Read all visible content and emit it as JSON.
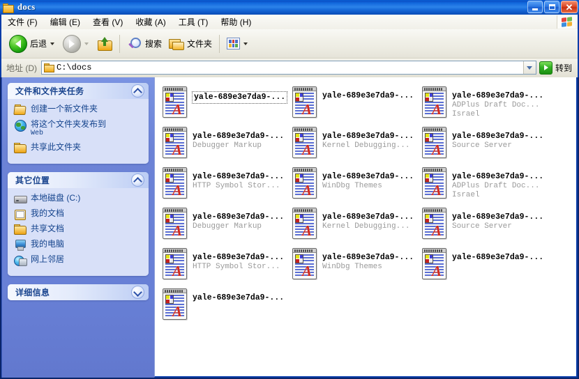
{
  "window": {
    "title": "docs",
    "title_icon": "folder-icon",
    "buttons": {
      "minimize": "minimize-button",
      "maximize": "maximize-button",
      "close": "close-button"
    }
  },
  "menubar": {
    "items": [
      {
        "label": "文件 (F)",
        "name": "menu-file"
      },
      {
        "label": "编辑 (E)",
        "name": "menu-edit"
      },
      {
        "label": "查看 (V)",
        "name": "menu-view"
      },
      {
        "label": "收藏 (A)",
        "name": "menu-favorites"
      },
      {
        "label": "工具 (T)",
        "name": "menu-tools"
      },
      {
        "label": "帮助 (H)",
        "name": "menu-help"
      }
    ],
    "logo": "windows-flag-icon"
  },
  "toolbar": {
    "back_label": "后退",
    "forward_label": "",
    "up_label": "",
    "search_label": "搜索",
    "folders_label": "文件夹",
    "views_label": ""
  },
  "address": {
    "label": "地址 (D)",
    "value": "C:\\docs",
    "go_label": "转到"
  },
  "sidebar": {
    "panels": [
      {
        "title": "文件和文件夹任务",
        "state": "expanded",
        "items": [
          {
            "label": "创建一个新文件夹",
            "sub": "",
            "icon": "new-folder-icon"
          },
          {
            "label": "将这个文件夹发布到",
            "sub": "Web",
            "icon": "globe-icon"
          },
          {
            "label": "共享此文件夹",
            "sub": "",
            "icon": "share-folder-icon"
          }
        ]
      },
      {
        "title": "其它位置",
        "state": "expanded",
        "items": [
          {
            "label": "本地磁盘 (C:)",
            "sub": "",
            "icon": "drive-icon"
          },
          {
            "label": "我的文档",
            "sub": "",
            "icon": "my-documents-icon"
          },
          {
            "label": "共享文档",
            "sub": "",
            "icon": "shared-documents-icon"
          },
          {
            "label": "我的电脑",
            "sub": "",
            "icon": "my-computer-icon"
          },
          {
            "label": "网上邻居",
            "sub": "",
            "icon": "network-places-icon"
          }
        ]
      },
      {
        "title": "详细信息",
        "state": "collapsed",
        "items": []
      }
    ]
  },
  "files": [
    {
      "name": "yale-689e3e7da9-...",
      "sub1": "",
      "sub2": "",
      "selected": true
    },
    {
      "name": "yale-689e3e7da9-...",
      "sub1": "",
      "sub2": "",
      "selected": false
    },
    {
      "name": "yale-689e3e7da9-...",
      "sub1": "ADPlus Draft Doc...",
      "sub2": "Israel",
      "selected": false
    },
    {
      "name": "yale-689e3e7da9-...",
      "sub1": "Debugger Markup",
      "sub2": "",
      "selected": false
    },
    {
      "name": "yale-689e3e7da9-...",
      "sub1": "Kernel Debugging...",
      "sub2": "",
      "selected": false
    },
    {
      "name": "yale-689e3e7da9-...",
      "sub1": "Source Server",
      "sub2": "",
      "selected": false
    },
    {
      "name": "yale-689e3e7da9-...",
      "sub1": "HTTP Symbol Stor...",
      "sub2": "",
      "selected": false
    },
    {
      "name": "yale-689e3e7da9-...",
      "sub1": "WinDbg Themes",
      "sub2": "",
      "selected": false
    },
    {
      "name": "yale-689e3e7da9-...",
      "sub1": "ADPlus Draft Doc...",
      "sub2": "Israel",
      "selected": false
    },
    {
      "name": "yale-689e3e7da9-...",
      "sub1": "Debugger Markup",
      "sub2": "",
      "selected": false
    },
    {
      "name": "yale-689e3e7da9-...",
      "sub1": "Kernel Debugging...",
      "sub2": "",
      "selected": false
    },
    {
      "name": "yale-689e3e7da9-...",
      "sub1": "Source Server",
      "sub2": "",
      "selected": false
    },
    {
      "name": "yale-689e3e7da9-...",
      "sub1": "HTTP Symbol Stor...",
      "sub2": "",
      "selected": false
    },
    {
      "name": "yale-689e3e7da9-...",
      "sub1": "WinDbg Themes",
      "sub2": "",
      "selected": false
    },
    {
      "name": "yale-689e3e7da9-...",
      "sub1": "",
      "sub2": "",
      "selected": false
    },
    {
      "name": "yale-689e3e7da9-...",
      "sub1": "",
      "sub2": "",
      "selected": false
    }
  ],
  "colors": {
    "titlebar": "#1167DC",
    "window_border": "#0A3CA8",
    "sidebar_bg": "#6C83D6",
    "panel_body": "#D8E0F8",
    "panel_link": "#14438C",
    "close_button": "#C42F12",
    "file_sub_text": "#9A9A9A"
  }
}
